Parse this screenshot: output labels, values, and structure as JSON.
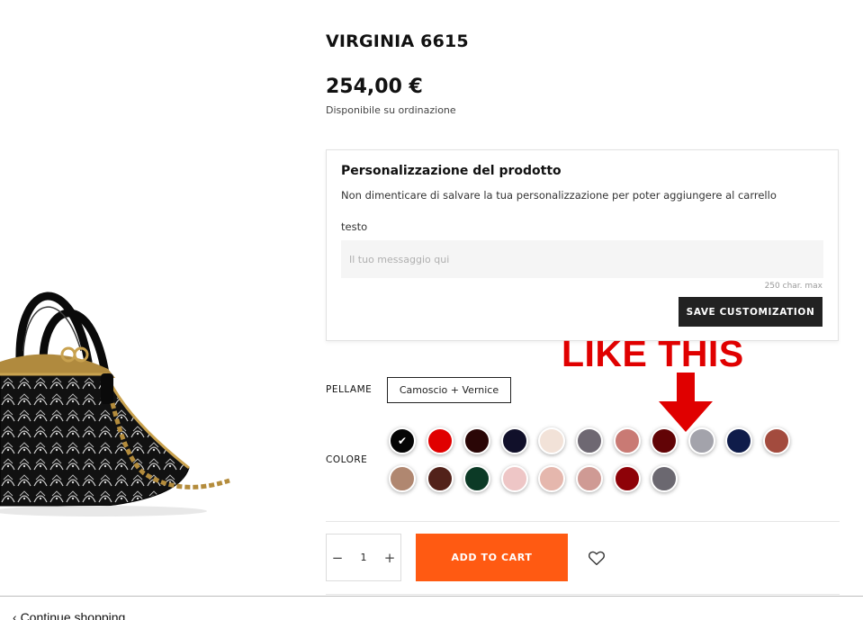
{
  "product": {
    "title": "VIRGINIA 6615",
    "price": "254,00 €",
    "availability": "Disponibile su ordinazione"
  },
  "customization": {
    "title": "Personalizzazione del prodotto",
    "note": "Non dimenticare di salvare la tua personalizzazione per poter aggiungere al carrello",
    "field_label": "testo",
    "field_value": "",
    "placeholder": "Il tuo messaggio qui",
    "char_max": "250 char. max",
    "save_label": "SAVE CUSTOMIZATION"
  },
  "annotation": {
    "text": "LIKE THIS",
    "color": "#e00000"
  },
  "options": {
    "pellame_label": "PELLAME",
    "pellame_value": "Camoscio + Vernice",
    "colore_label": "COLORE",
    "selected_index": 0,
    "swatches": [
      "#050505",
      "#e00000",
      "#2a0606",
      "#11102a",
      "#f2e2d8",
      "#6e6872",
      "#c97a74",
      "#620406",
      "#a3a3ab",
      "#0f1c4a",
      "#a34b3e",
      "#b08770",
      "#52221a",
      "#0c3a26",
      "#eec6c6",
      "#e5b7ad",
      "#cf9a94",
      "#8e0208",
      "#6b6870"
    ]
  },
  "cart": {
    "quantity": "1",
    "minus": "−",
    "plus": "+",
    "add_label": "ADD TO CART",
    "accent": "#ff5a12"
  },
  "footer": {
    "continue_label": "Continue shopping"
  }
}
